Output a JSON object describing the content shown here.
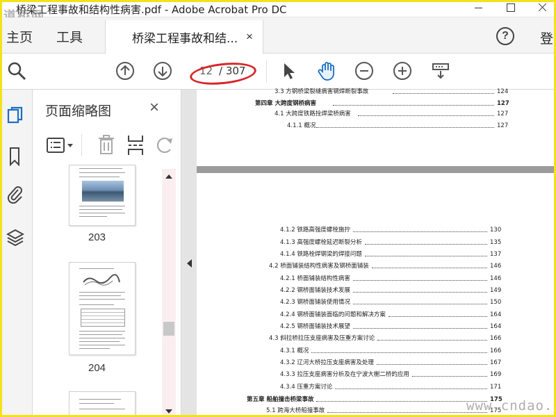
{
  "window": {
    "title": "桥梁工程事故和结构性病害.pdf - Adobe Acrobat Pro DC",
    "logo_text": "道桥网"
  },
  "tabs": {
    "home": "主页",
    "tools": "工具",
    "document": "桥梁工程事故和结...",
    "close": "×",
    "login": "登"
  },
  "toolbar": {
    "page_current": "12",
    "page_total": "/ 307",
    "icons": [
      "search-icon",
      "page-up-icon",
      "page-down-icon",
      "select-cursor-icon",
      "hand-icon",
      "zoom-out-icon",
      "zoom-in-icon",
      "scroll-mode-icon"
    ]
  },
  "thumbnails_panel": {
    "title": "页面缩略图",
    "close": "×",
    "pages": [
      {
        "label": "203"
      },
      {
        "label": "204"
      }
    ]
  },
  "toc_top": [
    {
      "title": "3.3 方钢桥梁裂缝病害钢焊断裂事故",
      "page": "124"
    },
    {
      "title": "第四章  大跨度钢桥病害",
      "page": "127"
    },
    {
      "title": "4.1 大跨度铁路拴焊梁桥病害",
      "page": "127"
    },
    {
      "title": "4.1.1 概况",
      "page": "127"
    }
  ],
  "toc_main": [
    {
      "title": "4.1.2 铁路高强度螺栓施拧",
      "page": "130"
    },
    {
      "title": "4.1.3 高强度螺栓延迟断裂分析",
      "page": "135"
    },
    {
      "title": "4.1.4 铁路栓焊钢梁的焊接问题",
      "page": "137"
    },
    {
      "title": "4.2  桥面铺装结构性病害及钢桥面铺装",
      "page": "146"
    },
    {
      "title": "4.2.1 桥面铺装结构性病害",
      "page": "146"
    },
    {
      "title": "4.2.2 钢桥面铺装技术发展",
      "page": "149"
    },
    {
      "title": "4.2.3 钢桥面铺装使用情况",
      "page": "150"
    },
    {
      "title": "4.2.4 钢桥面铺装面临的问题和解决方案",
      "page": "164"
    },
    {
      "title": "4.2.5 钢桥面铺装技术展望",
      "page": "164"
    },
    {
      "title": "4.3  斜拉桥拉压支座病害及压重方案讨论",
      "page": "166"
    },
    {
      "title": "4.3.1 概况",
      "page": "166"
    },
    {
      "title": "4.3.2 辽河大桥拉压支座病害及处理",
      "page": "167"
    },
    {
      "title": "4.3.3 拉压支座病害分析及在宁波大榭二桥的应用",
      "page": "169"
    },
    {
      "title": "4.3.4 压重方案讨论",
      "page": "171"
    },
    {
      "title": "第五章   船舶撞击桥梁事故",
      "page": "175"
    },
    {
      "title": "5.1  跨海大桥船撞事故",
      "page": "175"
    }
  ],
  "watermark": "www.cndao.com"
}
